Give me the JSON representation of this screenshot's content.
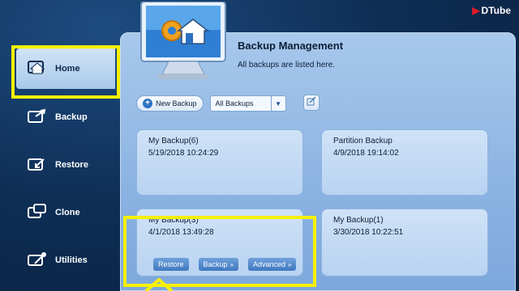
{
  "logo": {
    "text": "DTube"
  },
  "sidebar": {
    "items": [
      {
        "label": "Home",
        "icon": "home-icon",
        "active": true
      },
      {
        "label": "Backup",
        "icon": "backup-icon",
        "active": false
      },
      {
        "label": "Restore",
        "icon": "restore-icon",
        "active": false
      },
      {
        "label": "Clone",
        "icon": "clone-icon",
        "active": false
      },
      {
        "label": "Utilities",
        "icon": "utilities-icon",
        "active": false
      }
    ]
  },
  "header": {
    "title": "Backup Management",
    "subtitle": "All backups are listed here."
  },
  "toolbar": {
    "new_backup": "New Backup",
    "filter_value": "All Backups"
  },
  "backups": [
    {
      "name": "My Backup(6)",
      "date": "5/19/2018 10:24:29"
    },
    {
      "name": "Partition Backup",
      "date": "4/9/2018 19:14:02"
    },
    {
      "name": "My Backup(3)",
      "date": "4/1/2018 13:49:28"
    },
    {
      "name": "My Backup(1)",
      "date": "3/30/2018 10:22:51"
    }
  ],
  "card_actions": {
    "restore": "Restore",
    "backup": "Backup",
    "advanced": "Advanced"
  },
  "colors": {
    "highlight": "#f7f000",
    "panel": "#a8c8ec",
    "accent": "#2d72c2"
  }
}
